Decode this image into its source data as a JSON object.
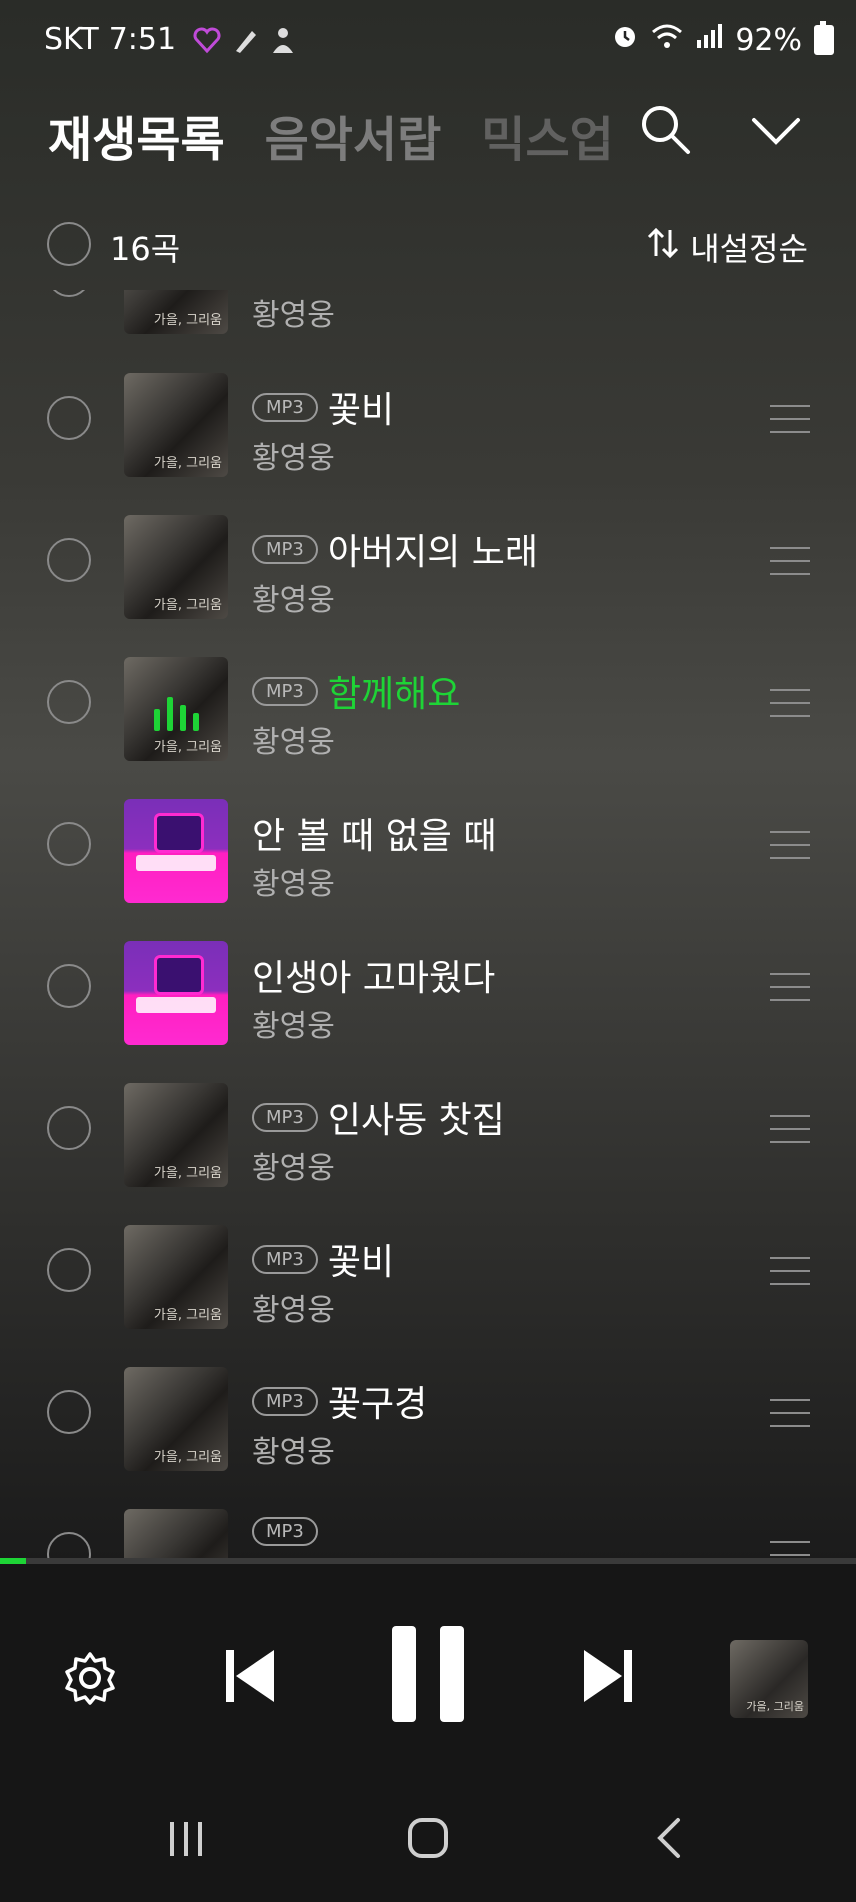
{
  "status_bar": {
    "carrier": "SKT",
    "time": "7:51",
    "battery_percent": "92%",
    "icons": [
      "heart-icon",
      "feather-icon",
      "person-icon",
      "alarm-icon",
      "wifi-icon",
      "signal-icon",
      "battery-icon"
    ]
  },
  "tabs": {
    "playlist": "재생목록",
    "library": "음악서랍",
    "mixup": "믹스업"
  },
  "list_header": {
    "count_label": "16곡",
    "sort_label": "내설정순"
  },
  "songs": [
    {
      "title": "",
      "artist": "황영웅",
      "mp3": false,
      "art": "ga",
      "playing": false
    },
    {
      "title": "꽃비",
      "artist": "황영웅",
      "mp3": true,
      "art": "ga",
      "playing": false
    },
    {
      "title": "아버지의 노래",
      "artist": "황영웅",
      "mp3": true,
      "art": "ga",
      "playing": false
    },
    {
      "title": "함께해요",
      "artist": "황영웅",
      "mp3": true,
      "art": "ga",
      "playing": true
    },
    {
      "title": "안 볼 때 없을 때",
      "artist": "황영웅",
      "mp3": false,
      "art": "pink",
      "playing": false
    },
    {
      "title": "인생아 고마웠다",
      "artist": "황영웅",
      "mp3": false,
      "art": "pink",
      "playing": false
    },
    {
      "title": "인사동 찻집",
      "artist": "황영웅",
      "mp3": true,
      "art": "ga",
      "playing": false
    },
    {
      "title": "꽃비",
      "artist": "황영웅",
      "mp3": true,
      "art": "ga",
      "playing": false
    },
    {
      "title": "꽃구경",
      "artist": "황영웅",
      "mp3": true,
      "art": "ga",
      "playing": false
    },
    {
      "title": "",
      "artist": "",
      "mp3": true,
      "art": "ga",
      "playing": false
    }
  ],
  "labels": {
    "mp3_badge": "MP3",
    "album_caption": "가을, 그리움"
  },
  "player": {
    "progress_fraction": 0.03
  },
  "colors": {
    "accent": "#1ed436",
    "playing_title": "#1ed436"
  }
}
